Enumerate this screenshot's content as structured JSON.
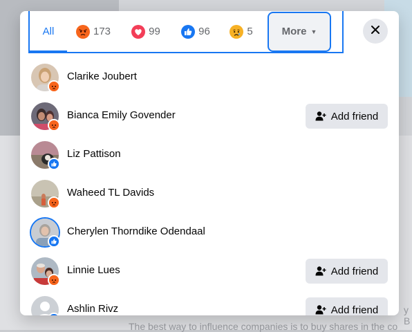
{
  "tabs": {
    "all_label": "All",
    "angry_count": "173",
    "love_count": "99",
    "like_count": "96",
    "sad_count": "5",
    "more_label": "More",
    "reaction_icons": [
      "angry-icon",
      "love-icon",
      "like-icon",
      "sad-icon"
    ],
    "active_color": "#1877f2"
  },
  "colors": {
    "angry": "#f7651c",
    "love": "#f33e58",
    "like": "#1877f2",
    "sad": "#f7b125"
  },
  "people": [
    {
      "name": "Clarike Joubert",
      "reaction": "angry",
      "add_friend": false
    },
    {
      "name": "Bianca Emily Govender",
      "reaction": "angry",
      "add_friend": true
    },
    {
      "name": "Liz Pattison",
      "reaction": "like",
      "add_friend": false
    },
    {
      "name": "Waheed TL Davids",
      "reaction": "angry",
      "add_friend": false
    },
    {
      "name": "Cherylen Thorndike Odendaal",
      "reaction": "like",
      "add_friend": false
    },
    {
      "name": "Linnie Lues",
      "reaction": "angry",
      "add_friend": true
    },
    {
      "name": "Ashlin Rivz",
      "reaction": "like",
      "add_friend": true
    }
  ],
  "add_friend_label": "Add friend",
  "background": {
    "footer_text": "The best way to influence companies is to buy shares in the co",
    "side_text": "y B"
  }
}
